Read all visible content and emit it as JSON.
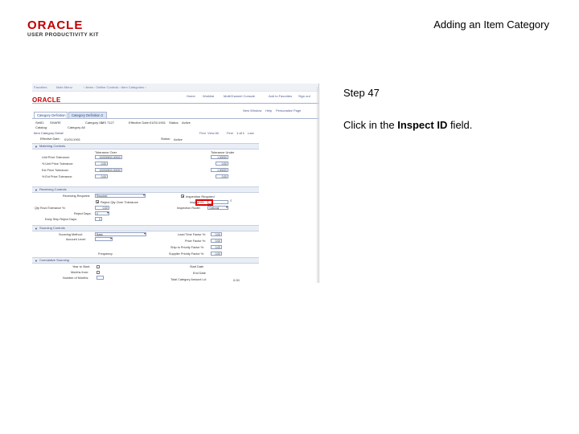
{
  "header": {
    "logo_top": "ORACLE",
    "logo_bottom": "USER PRODUCTIVITY KIT",
    "title": "Adding an Item Category"
  },
  "instructions": {
    "step": "Step 47",
    "prefix": "Click in the ",
    "target": "Inspect ID",
    "suffix": " field."
  },
  "screenshot": {
    "nav": {
      "favorites": "Favorites",
      "main_menu": "Main Menu",
      "path": "› Items › Define Controls › Item Categories ›",
      "home": "Home",
      "worklist": "Worklist",
      "multichannel": "MultiChannel Console",
      "add_to_favorites": "Add to Favorites",
      "sign_out": "Sign out"
    },
    "brand": "ORACLE",
    "toplinks": {
      "new_window": "New Window",
      "help": "Help",
      "personalize": "Personalize Page"
    },
    "tabs": [
      "Category Definition",
      "Category Definition 2"
    ],
    "form": {
      "setid_label": "SetID:",
      "setid_value": "SHARE",
      "category_id_label": "Category ID:",
      "category_id_value": "MS 7127",
      "catalog_label": "Catalog:",
      "catalog_value": "Category All",
      "effective_date_label": "Effective Date:",
      "effective_date_value": "01/01/1901",
      "status_label": "Status:",
      "status_value": "Active",
      "details_label": "Item Category Detail",
      "find_label": "Find",
      "view_all_label": "View All",
      "first_label": "First",
      "nav_count": "1 of 1",
      "last_label": "Last"
    },
    "sections": {
      "matching": "Matching Controls",
      "receiving": "Receiving Controls",
      "sourcing": "Sourcing Controls",
      "cumulative": "Cumulative Sourcing"
    },
    "matching": {
      "tol_over_label": "Tolerance Over",
      "tol_under_label": "Tolerance Under",
      "rows": [
        {
          "label": "Unit Price Tolerance:",
          "over": "100000000.00000",
          "under": "1.00000"
        },
        {
          "label": "% Unit Price Tolerance:",
          "over": "0.00",
          "under": "0.00"
        },
        {
          "label": "Ext Price Tolerance:",
          "over": "100000000.00000",
          "under": "1.00000"
        },
        {
          "label": "% Ext Price Tolerance:",
          "over": "0.00",
          "under": "0.00"
        }
      ]
    },
    "receiving": {
      "receiving_required_label": "Receiving Required:",
      "receiving_required_value": "Required",
      "inspection_required_label": "Inspection Required",
      "reject_qty_label": "Reject Qty Over Tolerance",
      "inspect_id_label": "Inspect ID:",
      "qty_rcvd_label": "Qty Rcvd Tolerance %:",
      "qty_rcvd_value": "0.00",
      "inspection_route_label": "Inspection Route:",
      "inspection_route_value": "Optional",
      "reject_days_label": "Reject Days:",
      "reject_days_value": "0",
      "early_ship_label": "Early Ship Reject Days:",
      "early_ship_value": "0"
    },
    "sourcing": {
      "lead_time_label": "Lead Time Factor %:",
      "lead_time_value": "0.00",
      "sourcing_method_label": "Sourcing Method:",
      "sourcing_method_value": "Basic",
      "price_factor_label": "Price Factor %:",
      "price_factor_value": "0.00",
      "account_level_label": "Account Level:",
      "ship_to_priority_label": "Ship to Priority Factor %:",
      "ship_to_priority_value": "0.00",
      "supplier_priority_label": "Supplier Priority Factor %:",
      "supplier_priority_value": "0.00",
      "frequency_label": "Frequency"
    },
    "cumulative": {
      "year_to_start_label": "Year to Start:",
      "start_date_label": "Start Date",
      "months_label": "Months from:",
      "end_date_label": "End Date",
      "number_of_months_label": "Number of Months:",
      "total_label": "Total Category Amount Ld:",
      "total_value": "0.00"
    }
  },
  "colors": {
    "oracle_red": "#c00000",
    "highlight_red": "#e00000",
    "section_bg": "#e9edf5",
    "link_blue": "#4d5c8a"
  }
}
